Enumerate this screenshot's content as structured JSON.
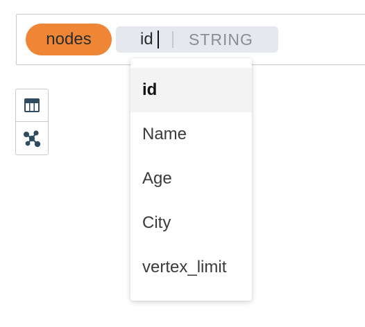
{
  "query_bar": {
    "node_label": "nodes",
    "property": {
      "name": "id",
      "type": "STRING"
    }
  },
  "view_toggle": {
    "buttons": [
      {
        "icon": "table-icon"
      },
      {
        "icon": "graph-icon"
      }
    ]
  },
  "dropdown": {
    "selected": "id",
    "items": [
      {
        "label": "id"
      },
      {
        "label": "Name"
      },
      {
        "label": "Age"
      },
      {
        "label": "City"
      },
      {
        "label": "vertex_limit"
      }
    ]
  },
  "colors": {
    "node_pill": "#ef8636",
    "chip_background": "#e5e8ee",
    "icon": "#2f4b5e"
  }
}
